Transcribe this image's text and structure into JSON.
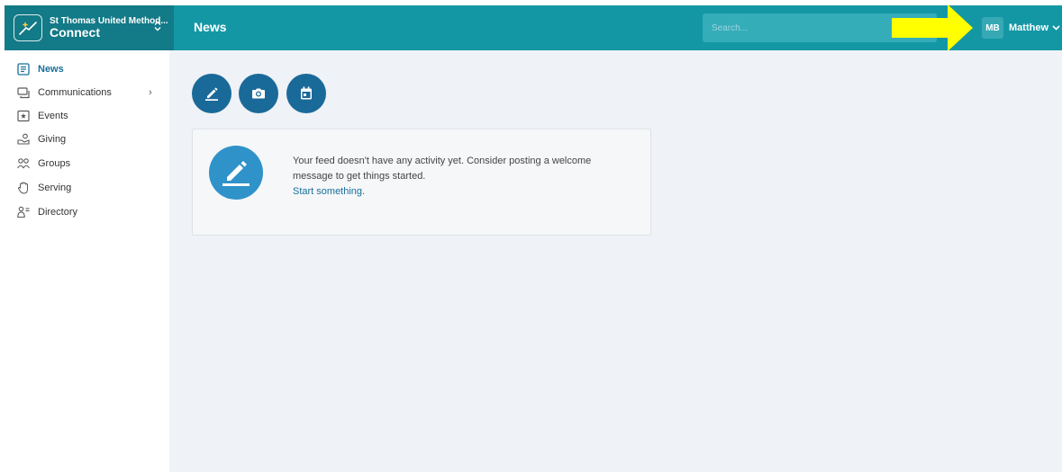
{
  "org": {
    "name": "St Thomas United Method...",
    "app_name": "Connect"
  },
  "header": {
    "title": "News"
  },
  "search": {
    "placeholder": "Search..."
  },
  "user": {
    "initials": "MB",
    "name": "Matthew"
  },
  "sidebar": {
    "items": [
      {
        "label": "News",
        "icon": "news-icon",
        "active": true
      },
      {
        "label": "Communications",
        "icon": "communications-icon",
        "has_submenu": true
      },
      {
        "label": "Events",
        "icon": "events-icon"
      },
      {
        "label": "Giving",
        "icon": "giving-icon"
      },
      {
        "label": "Groups",
        "icon": "groups-icon"
      },
      {
        "label": "Serving",
        "icon": "serving-icon"
      },
      {
        "label": "Directory",
        "icon": "directory-icon"
      }
    ],
    "submenu_arrow": "›"
  },
  "actions": [
    {
      "icon": "pencil-icon"
    },
    {
      "icon": "camera-icon"
    },
    {
      "icon": "calendar-icon"
    }
  ],
  "empty_state": {
    "message": "Your feed doesn't have any activity yet. Consider posting a welcome message to get things started.",
    "link": "Start something."
  },
  "colors": {
    "topbar": "#1497a5",
    "org_switcher": "#137a87",
    "accent": "#1a6a99",
    "annotation_arrow": "#ffff00",
    "main_bg": "#eff2f6"
  }
}
